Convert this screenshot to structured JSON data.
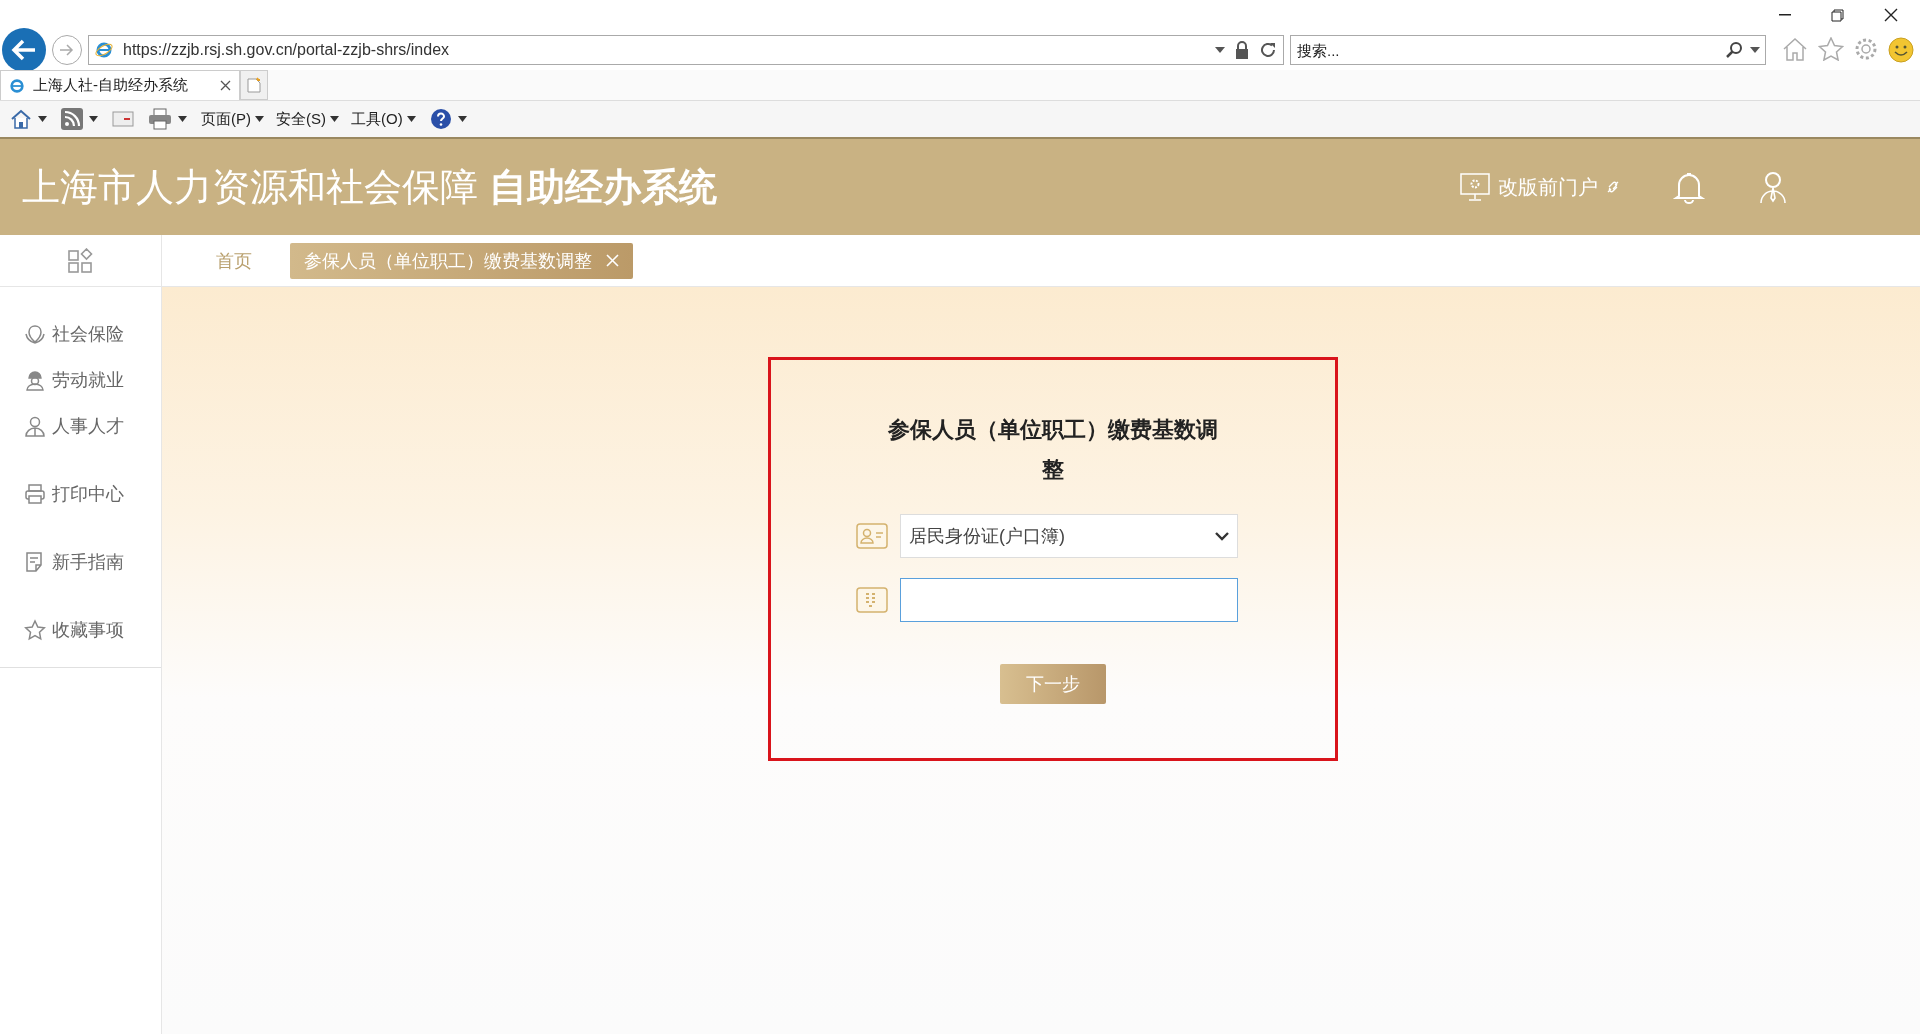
{
  "browser": {
    "url": "https://zzjb.rsj.sh.gov.cn/portal-zzjb-shrs/index",
    "search": {
      "placeholder": "搜索..."
    },
    "tab": {
      "title": "上海人社-自助经办系统",
      "selected": true
    },
    "menus": [
      {
        "label": "页面(P)"
      },
      {
        "label": "安全(S)"
      },
      {
        "label": "工具(O)"
      }
    ]
  },
  "header": {
    "title": "上海市人力资源和社会保障 **自助经办系统**",
    "portal_link": "改版前门户"
  },
  "tabs": [
    {
      "label": "首页",
      "selected": false,
      "closable": false
    },
    {
      "label": "参保人员（单位职工）缴费基数调整",
      "selected": true,
      "closable": true
    }
  ],
  "sidebar": [
    {
      "label": "社会保险",
      "kind": "shield"
    },
    {
      "label": "劳动就业",
      "kind": "worker"
    },
    {
      "label": "人事人才",
      "kind": "person"
    },
    {
      "label": "打印中心",
      "kind": "printer"
    },
    {
      "label": "新手指南",
      "kind": "guide"
    },
    {
      "label": "收藏事项",
      "kind": "star"
    }
  ],
  "form": {
    "title": "参保人员（单位职工）缴费基数调整",
    "id_type": {
      "value": "居民身份证(户口簿)"
    },
    "id_number": {
      "focused": true
    },
    "next_button": "下一步",
    "highlighted": true
  }
}
